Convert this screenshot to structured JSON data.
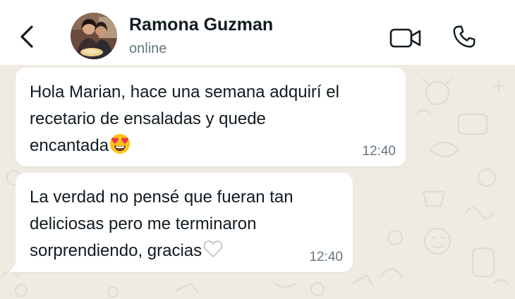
{
  "header": {
    "contact_name": "Ramona Guzman",
    "status": "online",
    "icons": {
      "back": "chevron-left-icon",
      "video": "video-call-icon",
      "call": "phone-icon"
    },
    "background_color": "#ffffff"
  },
  "chat": {
    "background_color": "#efeae2",
    "bubble_color": "#ffffff",
    "messages": [
      {
        "lines": [
          "Hola Marian, hace una semana adquirí el",
          "recetario de ensaladas y quede",
          "encantada"
        ],
        "emoji": "heart-eyes-emoji",
        "time": "12:40"
      },
      {
        "lines": [
          "La verdad no pensé que fueran tan",
          "deliciosas pero me terminaron",
          "sorprendiendo, gracias"
        ],
        "emoji": "white-heart-emoji",
        "time": "12:40"
      }
    ]
  },
  "colors": {
    "title": "#111b21",
    "secondary_text": "#667781",
    "emoji_face": "#fcc21b",
    "emoji_heart": "#e8354a"
  }
}
